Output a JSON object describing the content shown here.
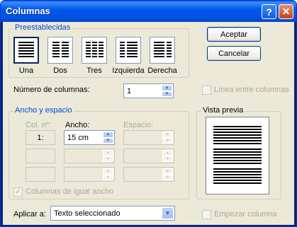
{
  "title": "Columnas",
  "titlebar": {
    "help_icon": "question-icon",
    "close_icon": "close-icon"
  },
  "presets": {
    "group_title": "Preestablecidas",
    "items": [
      {
        "label": "Una",
        "icon": "one-column-icon",
        "selected": true
      },
      {
        "label": "Dos",
        "icon": "two-columns-icon",
        "selected": false
      },
      {
        "label": "Tres",
        "icon": "three-columns-icon",
        "selected": false
      },
      {
        "label": "Izquierda",
        "icon": "left-column-icon",
        "selected": false
      },
      {
        "label": "Derecha",
        "icon": "right-column-icon",
        "selected": false
      }
    ]
  },
  "buttons": {
    "ok": "Aceptar",
    "cancel": "Cancelar"
  },
  "num_columns": {
    "label": "Número de columnas:",
    "value": "1"
  },
  "line_between": {
    "label": "Línea entre columnas",
    "checked": false
  },
  "width_spacing": {
    "group_title": "Ancho y espacio",
    "col_header": "Col. nº:",
    "width_header": "Ancho:",
    "spacing_header": "Espacio:",
    "rows": [
      {
        "col": "1:",
        "width": "15 cm",
        "spacing": ""
      },
      {
        "col": "",
        "width": "",
        "spacing": ""
      },
      {
        "col": "",
        "width": "",
        "spacing": ""
      }
    ],
    "equal_width": {
      "label": "Columnas de igual ancho",
      "checked": true
    }
  },
  "preview": {
    "title": "Vista previa"
  },
  "apply_to": {
    "label": "Aplicar a:",
    "value": "Texto seleccionado"
  },
  "new_column": {
    "label": "Empezar columna",
    "checked": false
  }
}
